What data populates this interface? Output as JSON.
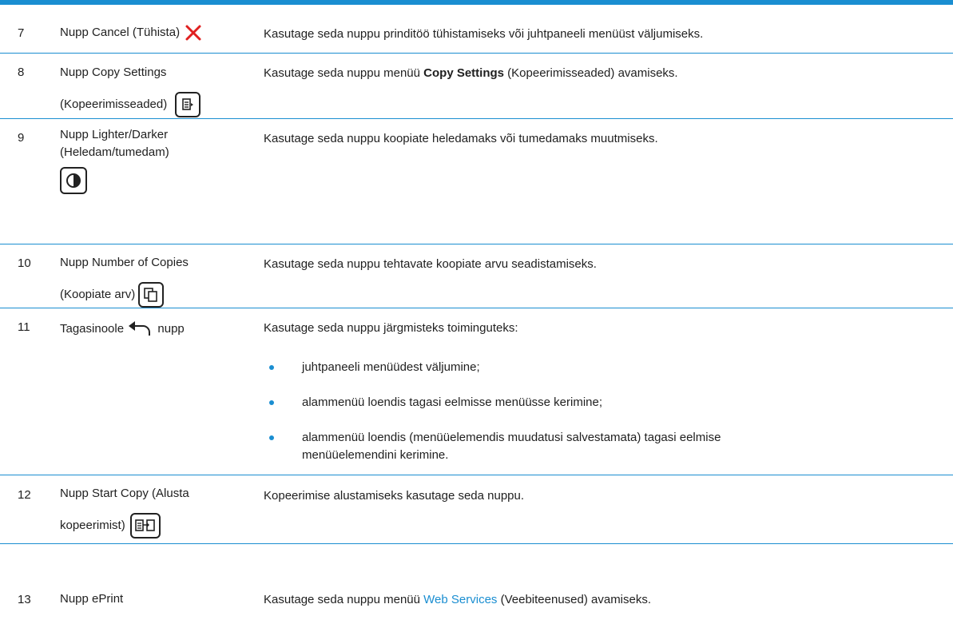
{
  "colors": {
    "accent": "#1a8ed1",
    "cancel_x": "#e02020"
  },
  "rows": [
    {
      "num": "7",
      "name": "Nupp Cancel (Tühista)",
      "desc": "Kasutage seda nuppu prinditöö tühistamiseks või juhtpaneeli menüüst väljumiseks."
    },
    {
      "num": "8",
      "name_line1": "Nupp Copy Settings",
      "name_line2": "(Kopeerimisseaded)",
      "desc_pre": "Kasutage seda nuppu menüü ",
      "desc_bold": "Copy Settings",
      "desc_post": " (Kopeerimisseaded) avamiseks."
    },
    {
      "num": "9",
      "name_line1": "Nupp Lighter/Darker",
      "name_line2": "(Heledam/tumedam)",
      "desc": "Kasutage seda nuppu koopiate heledamaks või tumedamaks muutmiseks."
    },
    {
      "num": "10",
      "name_line1": "Nupp Number of Copies",
      "name_line2": "(Koopiate arv)",
      "desc": "Kasutage seda nuppu tehtavate koopiate arvu seadistamiseks."
    },
    {
      "num": "11",
      "name_pre": "Tagasinoole",
      "name_post": "nupp",
      "desc": "Kasutage seda nuppu järgmisteks toiminguteks:",
      "bullets": [
        "juhtpaneeli menüüdest väljumine;",
        "alammenüü loendis tagasi eelmisse menüüsse kerimine;",
        "alammenüü loendis (menüüelemendis muudatusi salvestamata) tagasi eelmise",
        "menüüelemendini kerimine."
      ]
    },
    {
      "num": "12",
      "name_line1": "Nupp Start Copy (Alusta",
      "name_line2": "kopeerimist)",
      "desc": "Kopeerimise alustamiseks kasutage seda nuppu."
    },
    {
      "num": "13",
      "name": "Nupp ePrint",
      "desc_pre": "Kasutage seda nuppu menüü ",
      "desc_link": "Web Services",
      "desc_post": " (Veebiteenused) avamiseks."
    }
  ]
}
